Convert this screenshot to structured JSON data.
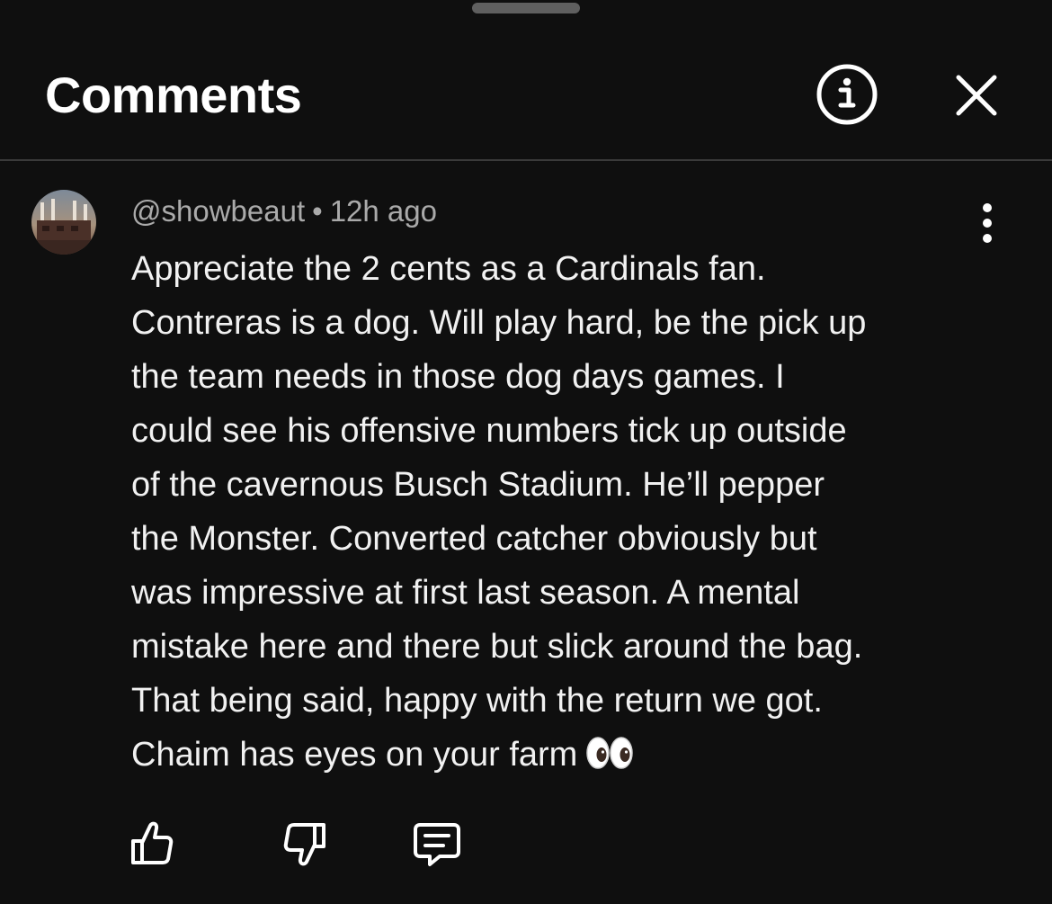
{
  "header": {
    "title": "Comments",
    "info_icon": "info-circle-icon",
    "close_icon": "close-icon"
  },
  "comment": {
    "handle": "@showbeaut",
    "separator": "•",
    "time": "12h ago",
    "body": "Appreciate the 2 cents as a Cardinals fan.\nContreras is a dog. Will play hard, be the pick up\nthe team needs in those dog days games. I\ncould see his offensive numbers tick up outside\nof the cavernous Busch Stadium. He’ll pepper\nthe Monster. Converted catcher obviously but\nwas impressive at first last season. A mental\nmistake here and there but slick around the bag.\nThat being said, happy with the return we got.\nChaim has eyes on your farm",
    "emoji": "eyes-emoji",
    "more_icon": "more-vertical-icon"
  },
  "actions": {
    "like_icon": "thumbs-up-icon",
    "dislike_icon": "thumbs-down-icon",
    "reply_icon": "reply-comment-icon"
  },
  "colors": {
    "background": "#0f0f0f",
    "text_primary": "#f1f1f1",
    "text_secondary": "#aaaaaa",
    "divider": "#3a3a3a"
  }
}
